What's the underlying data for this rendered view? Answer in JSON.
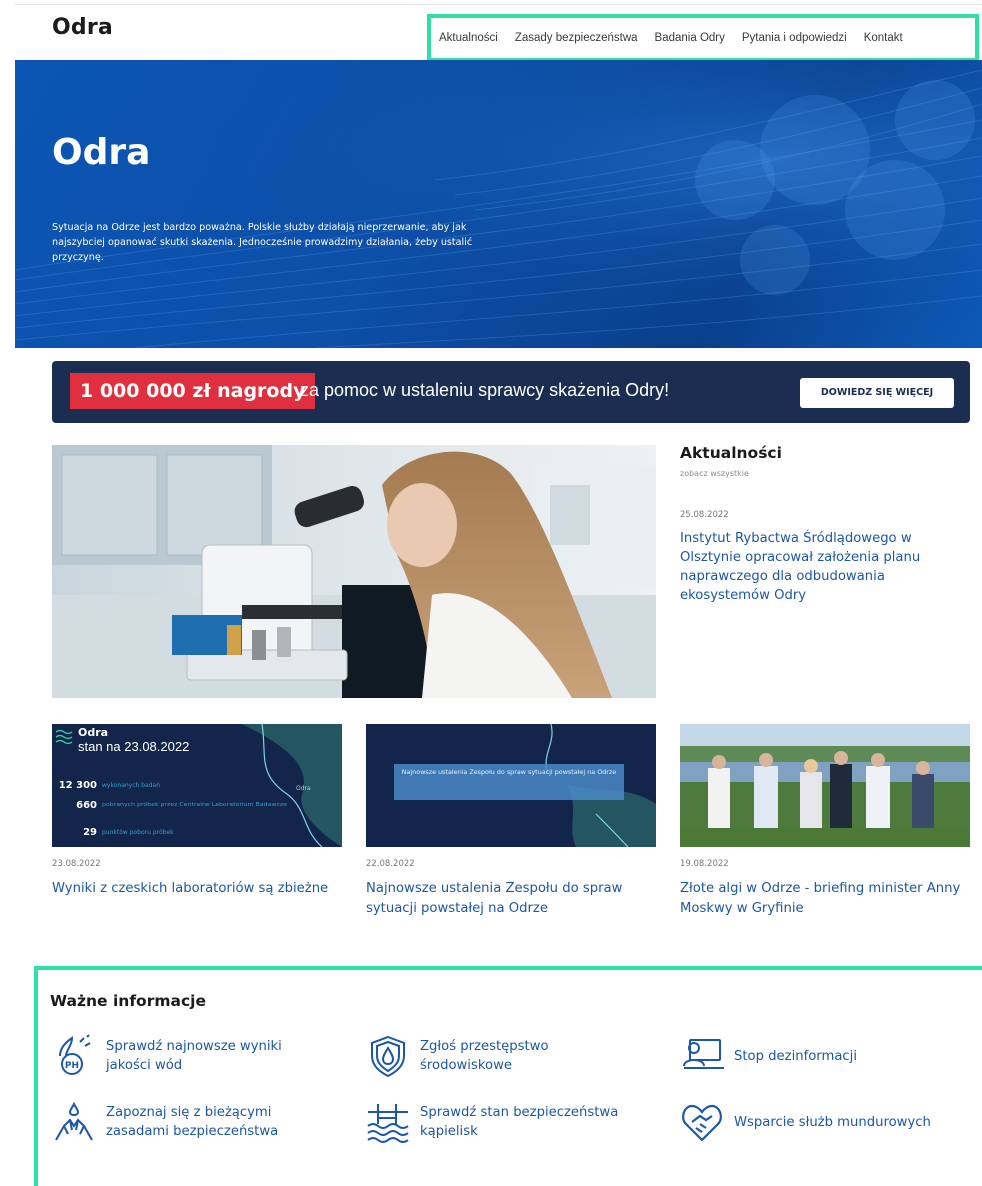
{
  "site": {
    "logo": "Odra"
  },
  "nav": {
    "items": [
      "Aktualności",
      "Zasady bezpieczeństwa",
      "Badania Odry",
      "Pytania i odpowiedzi",
      "Kontakt"
    ]
  },
  "hero": {
    "title": "Odra",
    "text": "Sytuacja na Odrze jest bardzo poważna. Polskie służby działają nieprzerwanie, aby jak najszybciej opanować skutki skażenia. Jednocześnie prowadzimy działania, żeby ustalić przyczynę."
  },
  "reward": {
    "amount": "1 000 000 zł nagrody",
    "text": "za pomoc w ustaleniu sprawcy skażenia Odry!",
    "button": "DOWIEDZ SIĘ WIĘCEJ"
  },
  "news": {
    "heading": "Aktualności",
    "see_all": "zobacz wszystkie",
    "date": "25.08.2022",
    "title": "Instytut Rybactwa Śródlądowego w Olsztynie opracował założenia planu naprawczego dla odbudowania ekosystemów Odry"
  },
  "cards": [
    {
      "date": "23.08.2022",
      "title": "Wyniki z czeskich laboratoriów są zbieżne",
      "thumb": {
        "heading": "Odra",
        "sub": "stan na 23.08.2022",
        "stats": [
          {
            "num": "12 300",
            "text": "wykonanych badań"
          },
          {
            "num": "660",
            "text": "pobranych próbek przez Centralne Laboratorium Badawcze"
          },
          {
            "num": "29",
            "text": "punktów poboru próbek"
          }
        ],
        "map_label": "Odra"
      }
    },
    {
      "date": "22.08.2022",
      "title": "Najnowsze ustalenia Zespołu do spraw sytuacji powstałej na Odrze",
      "thumb": {
        "caption": "Najnowsze ustalenia Zespołu do spraw sytuacji powstałej na Odrze"
      }
    },
    {
      "date": "19.08.2022",
      "title": "Złote algi w Odrze - briefing minister Anny Moskwy w Gryfinie"
    }
  ],
  "important": {
    "heading": "Ważne informacje",
    "items": [
      {
        "label": "Sprawdź najnowsze wyniki jakości wód",
        "icon": "ph-water-icon"
      },
      {
        "label": "Zgłoś przestępstwo środowiskowe",
        "icon": "shield-drop-icon"
      },
      {
        "label": "Stop dezinformacji",
        "icon": "laptop-user-icon"
      },
      {
        "label": "Zapoznaj się z bieżącymi zasadami bezpieczeństwa",
        "icon": "hands-drop-icon"
      },
      {
        "label": "Sprawdź stan bezpieczeństwa kąpielisk",
        "icon": "swimming-pool-icon"
      },
      {
        "label": "Wsparcie służb mundurowych",
        "icon": "heart-hands-icon"
      }
    ]
  },
  "colors": {
    "accent_green": "#2fe0a2",
    "link_blue": "#1d57a8",
    "reward_red": "#e0303f",
    "banner_navy": "#1a2e52"
  }
}
